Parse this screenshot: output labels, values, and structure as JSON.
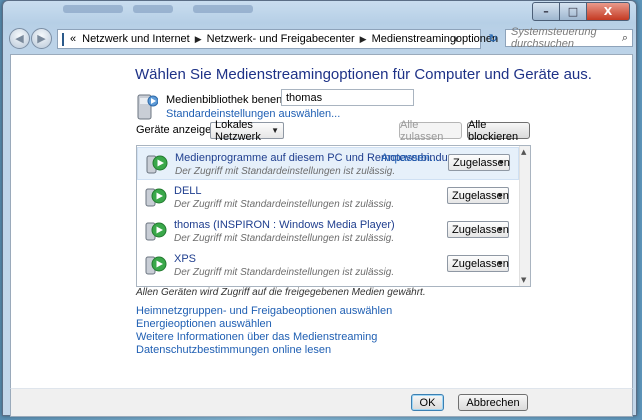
{
  "window": {
    "minimize_glyph": "–",
    "maximize_glyph": "□",
    "close_glyph": "X"
  },
  "nav": {
    "back_glyph": "◀",
    "forward_glyph": "▶",
    "overflow": "«",
    "breadcrumb": [
      "Netzwerk und Internet",
      "Netzwerk- und Freigabecenter",
      "Medienstreamingoptionen"
    ],
    "separator": "▶",
    "dropdown_glyph": "▼",
    "refresh_glyph": "↻",
    "search_placeholder": "Systemsteuerung durchsuchen",
    "search_glyph": "⌕"
  },
  "main": {
    "heading": "Wählen Sie Medienstreamingoptionen für Computer und Geräte aus.",
    "library_label": "Medienbibliothek benennen:",
    "library_value": "thomas",
    "defaults_link": "Standardeinstellungen auswählen...",
    "show_devices_label": "Geräte anzeigen in:",
    "show_devices_value": "Lokales Netzwerk",
    "allow_all": "Alle zulassen",
    "block_all": "Alle blockieren",
    "devices": [
      {
        "name": "Medienprogramme auf diesem PC und Remoteverbindunge...",
        "sub": "Der Zugriff mit Standardeinstellungen ist zulässig.",
        "custom": "Anpassen...",
        "status": "Zugelassen",
        "selected": true
      },
      {
        "name": "DELL",
        "sub": "Der Zugriff mit Standardeinstellungen ist zulässig.",
        "custom": "",
        "status": "Zugelassen",
        "selected": false
      },
      {
        "name": "thomas (INSPIRON : Windows Media Player)",
        "sub": "Der Zugriff mit Standardeinstellungen ist zulässig.",
        "custom": "",
        "status": "Zugelassen",
        "selected": false
      },
      {
        "name": "XPS",
        "sub": "Der Zugriff mit Standardeinstellungen ist zulässig.",
        "custom": "",
        "status": "Zugelassen",
        "selected": false
      }
    ],
    "note": "Allen Geräten wird Zugriff auf die freigegebenen Medien gewährt.",
    "links": [
      "Heimnetzgruppen- und Freigabeoptionen auswählen",
      "Energieoptionen auswählen",
      "Weitere Informationen über das Medienstreaming",
      "Datenschutzbestimmungen online lesen"
    ]
  },
  "footer": {
    "ok": "OK",
    "cancel": "Abbrechen"
  }
}
